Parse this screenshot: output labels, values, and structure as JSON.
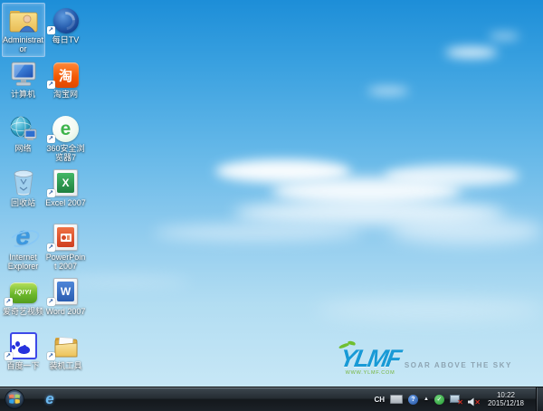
{
  "desktop": {
    "icons": [
      {
        "label": "Administrator",
        "selected": true,
        "shortcut": false
      },
      {
        "label": "每日TV",
        "shortcut": true
      },
      {
        "label": "计算机",
        "shortcut": false
      },
      {
        "label": "淘宝网",
        "shortcut": true
      },
      {
        "label": "网络",
        "shortcut": false
      },
      {
        "label": "360安全浏览器7",
        "shortcut": true
      },
      {
        "label": "回收站",
        "shortcut": false
      },
      {
        "label": "Excel 2007",
        "shortcut": true
      },
      {
        "label": "Internet Explorer",
        "shortcut": false
      },
      {
        "label": "PowerPoint 2007",
        "shortcut": true
      },
      {
        "label": "爱奇艺视频",
        "shortcut": true
      },
      {
        "label": "Word 2007",
        "shortcut": true
      },
      {
        "label": "百度一下",
        "shortcut": true
      },
      {
        "label": "装机工具",
        "shortcut": true
      }
    ]
  },
  "glyphs": {
    "shortcut_arrow": "↗",
    "taobao_char": "淘",
    "browser360_e": "e",
    "ie_e": "e",
    "excel_x": "X",
    "word_w": "W",
    "iqiyi_text": "iQIYI",
    "help": "?",
    "check": "✓",
    "hidden_icons_arrow": "▲",
    "close_x": "✕"
  },
  "watermark": {
    "logo": "YLMF",
    "url": "WWW.YLMF.COM",
    "tagline": "SOAR ABOVE THE SKY"
  },
  "taskbar": {
    "language_indicator": "CH",
    "clock_time": "10:22",
    "clock_date": "2015/12/18"
  },
  "colors": {
    "sky_top": "#1d8ed8",
    "sky_bottom": "#cdeaf7",
    "selection_blue": "#7ab8e8",
    "logo_blue": "#189ad6",
    "logo_green": "#6fbf2f",
    "taobao_orange": "#f25600",
    "excel_green": "#1f7f3f",
    "word_blue": "#2a5cb0",
    "ppt_red": "#cf3d1e",
    "iqiyi_green": "#6db82c",
    "baidu_blue": "#2932e1",
    "browser360_green": "#3fb44c"
  }
}
